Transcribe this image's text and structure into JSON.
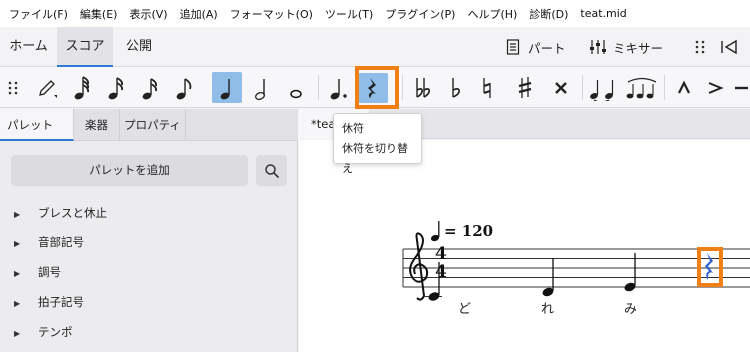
{
  "menu": {
    "file": "ファイル(F)",
    "edit": "編集(E)",
    "view": "表示(V)",
    "add": "追加(A)",
    "format": "フォーマット(O)",
    "tools": "ツール(T)",
    "plugins": "プラグイン(P)",
    "help": "ヘルプ(H)",
    "diagnose": "診断(D)",
    "filename": "teat.mid"
  },
  "workspace": {
    "home": "ホーム",
    "score": "スコア",
    "publish": "公開",
    "parts": "パート",
    "mixer": "ミキサー"
  },
  "toolbar": {
    "dot_label": ".",
    "active_items": [
      "quarter-note",
      "rest-toggle"
    ],
    "highlight_color": "#f07f14",
    "active_color": "#8fbde8"
  },
  "tooltip": {
    "title": "休符",
    "description": "休符を切り替え"
  },
  "panel": {
    "tabs": {
      "palettes": "パレット",
      "instruments": "楽器",
      "properties": "プロパティ"
    },
    "more": "···",
    "add_palette": "パレットを追加",
    "items": [
      "ブレスと休止",
      "音部記号",
      "調号",
      "拍子記号",
      "テンポ"
    ]
  },
  "score": {
    "tab_title": "*teat",
    "tempo_text": "= 120",
    "time_signature": {
      "top": "4",
      "bottom": "4"
    },
    "lyrics": [
      "ど",
      "れ",
      "み"
    ]
  }
}
